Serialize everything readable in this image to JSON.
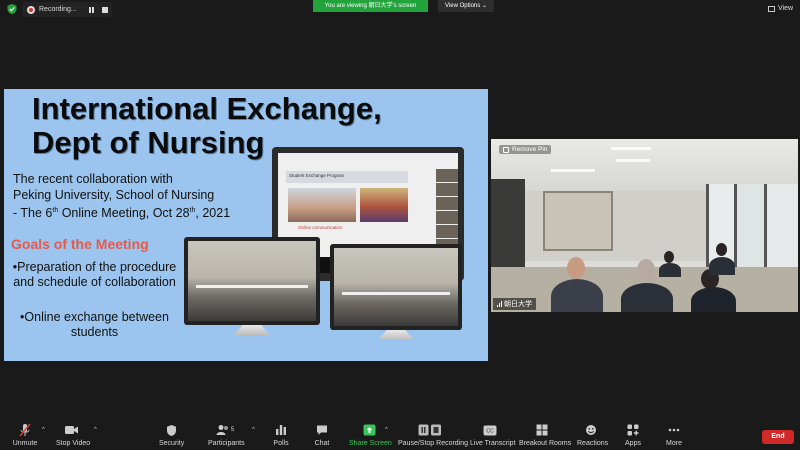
{
  "topbar": {
    "recording_label": "Recording...",
    "viewing_label": "You are viewing 朝日大学's screen",
    "view_options_label": "View Options ⌄",
    "view_label": "View"
  },
  "slide": {
    "title_line1": "International Exchange,",
    "title_line2": "Dept of Nursing",
    "sub_line1": "The recent collaboration with",
    "sub_line2": "Peking University, School of Nursing",
    "sub_line3_pre": "- The 6",
    "sub_line3_sup": "th",
    "sub_line3_post": " Online Meeting, Oct 28",
    "sub_line3_sup2": "th",
    "sub_line3_end": ", 2021",
    "goals_heading": "Goals of the Meeting",
    "bullet1": "•Preparation of the procedure and schedule of collaboration",
    "bullet2": "•Online exchange between students",
    "monitor_header": "Student Exchange Program",
    "monitor_caption": "Online communication"
  },
  "video": {
    "remove_pin_label": "Remove Pin",
    "participant_name": "朝日大学"
  },
  "toolbar": {
    "unmute": "Unmute",
    "stop_video": "Stop Video",
    "security": "Security",
    "participants": "Participants",
    "participants_count": "5",
    "polls": "Polls",
    "chat": "Chat",
    "share_screen": "Share Screen",
    "pause_stop_recording": "Pause/Stop Recording",
    "live_transcript": "Live Transcript",
    "breakout_rooms": "Breakout Rooms",
    "reactions": "Reactions",
    "apps": "Apps",
    "more": "More",
    "end": "End"
  },
  "colors": {
    "slide_bg": "#9bc5ee",
    "goals": "#e45a4c",
    "viewing_banner": "#23a33c",
    "end_button": "#d02a28",
    "share_icon": "#3bc45a"
  }
}
